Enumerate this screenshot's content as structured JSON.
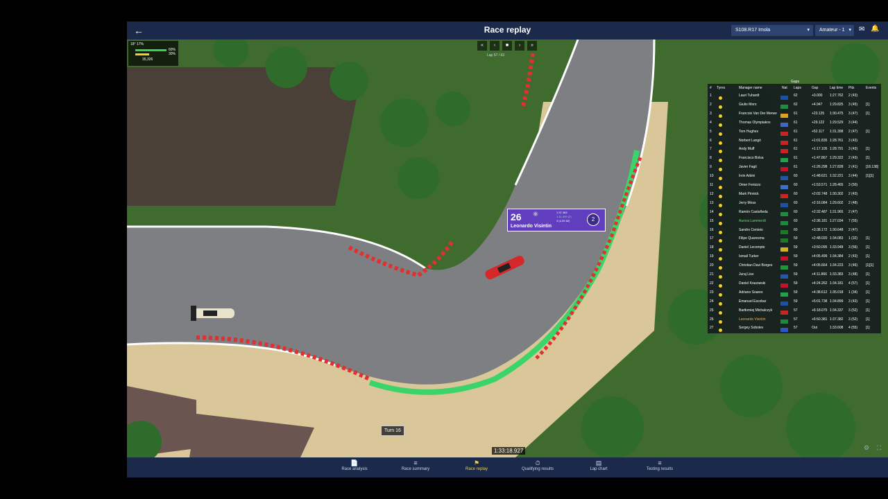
{
  "header": {
    "back_icon": "arrow-left-icon",
    "title": "Race replay",
    "series_select": "S108.R17 Imola",
    "level_select": "Amateur - 1"
  },
  "weather": {
    "temp": "18° 17%",
    "line1": "60%",
    "line2": "30%",
    "line3": "35,326"
  },
  "replay": {
    "lap_label": "Lap 57 / 63"
  },
  "driver_card": {
    "number": "26",
    "name": "Leonardo Visintin",
    "position": "2",
    "stats": [
      "1:37.383",
      "1:31.099 (2)",
      "3 (4,39 82)"
    ]
  },
  "standings": {
    "title": "Gaps",
    "columns": [
      "#",
      "Tyres",
      "Manager name",
      "Nat",
      "Laps",
      "Gap",
      "Lap time",
      "Pits",
      "Events"
    ],
    "rows": [
      [
        "1",
        "Lauri Tuhardt",
        "62",
        "+0.000",
        "1:27.762",
        "2 (43)",
        ""
      ],
      [
        "2",
        "Giulio Moro",
        "62",
        "+4.947",
        "1:29.825",
        "3 (45)",
        "[1]"
      ],
      [
        "3",
        "Francois Van Der Merwe",
        "61",
        "+23.125",
        "1:30.475",
        "3 (47)",
        "[1]"
      ],
      [
        "4",
        "Thomas Olympiakos",
        "61",
        "+29.122",
        "1:29.529",
        "3 (44)",
        ""
      ],
      [
        "5",
        "Tom Hughes",
        "61",
        "+52.117",
        "1:31.398",
        "2 (47)",
        "[1]"
      ],
      [
        "6",
        "Norbert Langó",
        "61",
        "+1:01.835",
        "1:28.761",
        "3 (43)",
        ""
      ],
      [
        "7",
        "Andy Muff",
        "61",
        "+1:17.105",
        "1:28.791",
        "3 (43)",
        "[1]"
      ],
      [
        "8",
        "Francisco Bolsa",
        "61",
        "+1:47.867",
        "1:29.322",
        "2 (43)",
        "[1]"
      ],
      [
        "9",
        "Javier Fagil",
        "61",
        "+1:26.298",
        "1:27.828",
        "2 (41)",
        "[18.138]"
      ],
      [
        "10",
        "Irvin Arbini",
        "60",
        "+1:48.621",
        "1:32.221",
        "3 (44)",
        "[1][1]"
      ],
      [
        "11",
        "Omer Fenizzo",
        "60",
        "+1:53.571",
        "1:28.465",
        "3 (50)",
        ""
      ],
      [
        "12",
        "Mark Pinnick",
        "60",
        "+2:02.748",
        "1:30.302",
        "2 (43)",
        ""
      ],
      [
        "13",
        "Jerry Moss",
        "60",
        "+2:16.084",
        "1:29.602",
        "2 (48)",
        ""
      ],
      [
        "14",
        "Ramón Castañeda",
        "60",
        "+2:32.487",
        "1:31.965",
        "2 (47)",
        ""
      ],
      [
        "15",
        "Aurora Lammerdt",
        "60",
        "+2:36.181",
        "1:27.034",
        "7 (55)",
        ""
      ],
      [
        "16",
        "Sandro Centeio",
        "60",
        "+3:38.172",
        "1:30.648",
        "2 (47)",
        ""
      ],
      [
        "17",
        "Filipe Quaresma",
        "59",
        "+2:48.020",
        "1:34.083",
        "1 (32)",
        "[1]"
      ],
      [
        "18",
        "Daniel Lecompte",
        "59",
        "+3:50.095",
        "1:33.948",
        "3 (56)",
        "[1]"
      ],
      [
        "19",
        "Ismail Turker",
        "59",
        "+4:05.499",
        "1:34.384",
        "2 (43)",
        "[1]"
      ],
      [
        "20",
        "Christian Davi Borges",
        "59",
        "+4:05.664",
        "1:34.223",
        "3 (46)",
        "[1][1]"
      ],
      [
        "21",
        "Juraj Liso",
        "59",
        "+4:11.866",
        "1:33.383",
        "3 (48)",
        "[1]"
      ],
      [
        "22",
        "Daniel Krasowski",
        "59",
        "+4:24.262",
        "1:34.181",
        "4 (57)",
        "[1]"
      ],
      [
        "23",
        "Adriano Soares",
        "59",
        "+4:38.612",
        "1:35.018",
        "1 (34)",
        "[1]"
      ],
      [
        "24",
        "Emanuel Escobar",
        "59",
        "+5:01.738",
        "1:34.899",
        "3 (43)",
        "[1]"
      ],
      [
        "25",
        "Bartłomiej Michalczyk",
        "57",
        "+6:18.075",
        "1:34.337",
        "3 (52)",
        "[1]"
      ],
      [
        "26",
        "Leonardo Visintin",
        "57",
        "+6:50.381",
        "1:37.382",
        "3 (52)",
        "[1]"
      ],
      [
        "27",
        "Sergey Sobolev",
        "57",
        "Out",
        "1:33.608",
        "4 (55)",
        "[1]"
      ]
    ],
    "flag_colors": [
      "#1b4fa8",
      "#1c8f3c",
      "#e0a020",
      "#3f66c4",
      "#cc2222",
      "#cc2222",
      "#d02020",
      "#1ea34a",
      "#c8102e",
      "#2255aa",
      "#3a6fd0",
      "#cc2222",
      "#1b4fa8",
      "#1e8a3c",
      "#1b8a3a",
      "#1b7a2a",
      "#1b7a2a",
      "#d8b21e",
      "#c8102e",
      "#1b9a3a",
      "#2b55aa",
      "#c8102e",
      "#1ea34a",
      "#1b4fa8",
      "#cc2222",
      "#1b8a3a",
      "#2b55cc"
    ]
  },
  "map": {
    "turn_label": "Turn 16",
    "clock": "1:33:18.927"
  },
  "nav": {
    "items": [
      {
        "label": "Race analysis",
        "icon": "doc-icon"
      },
      {
        "label": "Race summary",
        "icon": "list-icon"
      },
      {
        "label": "Race replay",
        "icon": "flag-icon"
      },
      {
        "label": "Qualifying results",
        "icon": "timer-icon"
      },
      {
        "label": "Lap chart",
        "icon": "chart-icon"
      },
      {
        "label": "Testing results",
        "icon": "list-icon"
      }
    ],
    "active_color": "#f4d03f"
  }
}
